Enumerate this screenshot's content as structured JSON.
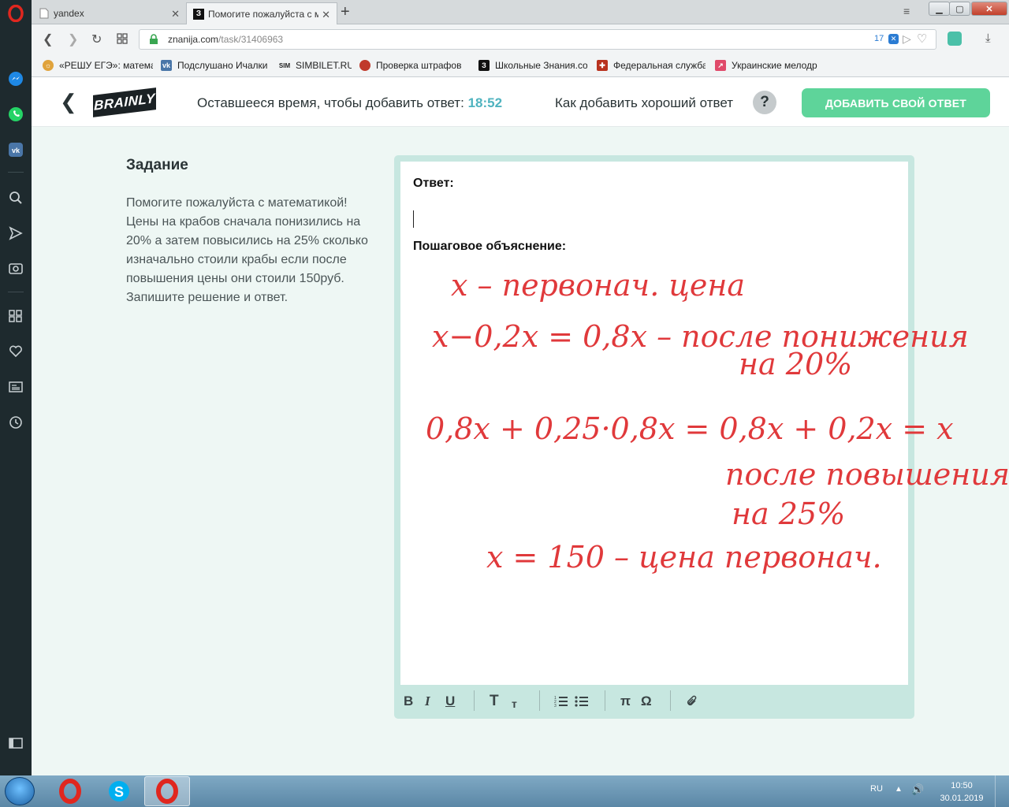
{
  "browser": {
    "tabs": [
      {
        "label": "yandex"
      },
      {
        "label": "Помогите пожалуйста с м"
      }
    ],
    "url_domain": "znanija.com",
    "url_path": "/task/31406963",
    "badge_count": "17",
    "bookmarks": [
      {
        "label": "«РЕШУ ЕГЭ»: матема",
        "color": "#e0a33c"
      },
      {
        "label": "Подслушано Ичалки",
        "color": "#4a76a8"
      },
      {
        "label": "SIMBILET.RU",
        "color": "#333333"
      },
      {
        "label": "Проверка штрафов",
        "color": "#c0392b"
      },
      {
        "label": "Школьные Знания.co",
        "color": "#111111"
      },
      {
        "label": "Федеральная служба",
        "color": "#b8321e"
      },
      {
        "label": "Украинские мелодр",
        "color": "#e04a6a"
      }
    ]
  },
  "header": {
    "logo": "BRAINLY",
    "timer_label": "Оставшееся время, чтобы добавить ответ:",
    "timer_value": "18:52",
    "howto_label": "Как добавить хороший ответ",
    "help_symbol": "?",
    "add_answer_label": "ДОБАВИТЬ СВОЙ ОТВЕТ"
  },
  "task": {
    "title": "Задание",
    "text": "Помогите пожалуйста с математикой! Цены на крабов сначала понизились на 20% а затем повысились на 25% сколько изначально стоили крабы если после повышения цены они стоили 150руб. Запишите решение и ответ."
  },
  "editor": {
    "answer_label": "Ответ:",
    "explanation_label": "Пошаговое объяснение:",
    "handwriting": [
      "x – первонач. цена",
      "x−0,2x = 0,8x  – после понижения",
      "на 20%",
      "0,8x + 0,25·0,8x = 0,8x + 0,2x = x",
      "после повышения",
      "на 25%",
      "x = 150  – цена первонач."
    ],
    "handwriting_color": "#e0393b",
    "toolbar": {
      "bold": "B",
      "italic": "I",
      "underline": "U",
      "text_large": "T",
      "text_small": "т",
      "pi": "π",
      "omega": "Ω"
    }
  },
  "taskbar": {
    "language": "RU",
    "time": "10:50",
    "date": "30.01.2019"
  }
}
